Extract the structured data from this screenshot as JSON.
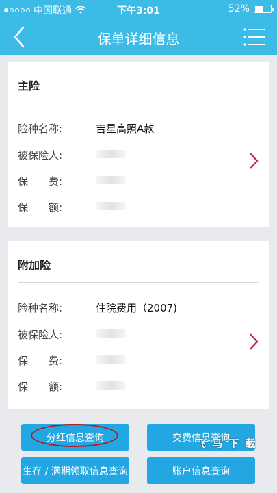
{
  "status": {
    "carrier": "中国联通",
    "time": "下午3:01",
    "battery": "52%",
    "battery_level": 0.52
  },
  "nav": {
    "title": "保单详细信息",
    "back_icon": "back-arrow-icon",
    "menu_icon": "menu-icon"
  },
  "main_policy": {
    "heading": "主险",
    "rows": [
      {
        "label": "险种名称:",
        "value": "吉星高照A款"
      },
      {
        "label": "被保险人:",
        "value": ""
      },
      {
        "label": "保　　费:",
        "value": ""
      },
      {
        "label": "保　　额:",
        "value": ""
      }
    ]
  },
  "rider_policy": {
    "heading": "附加险",
    "rows": [
      {
        "label": "险种名称:",
        "value": "住院费用（2007)"
      },
      {
        "label": "被保险人:",
        "value": ""
      },
      {
        "label": "保　　费:",
        "value": ""
      },
      {
        "label": "保　　额:",
        "value": ""
      }
    ]
  },
  "buttons": {
    "dividend": "分红信息查询",
    "payment": "交费信息查询",
    "survival": "生存 / 满期领取信息查询",
    "account": "账户信息查询"
  },
  "watermark": "飞 马 下 载",
  "colors": {
    "accent": "#3cbbe6",
    "button": "#22a7e2",
    "chevron": "#c8264e",
    "highlight_circle": "#c4141c"
  }
}
